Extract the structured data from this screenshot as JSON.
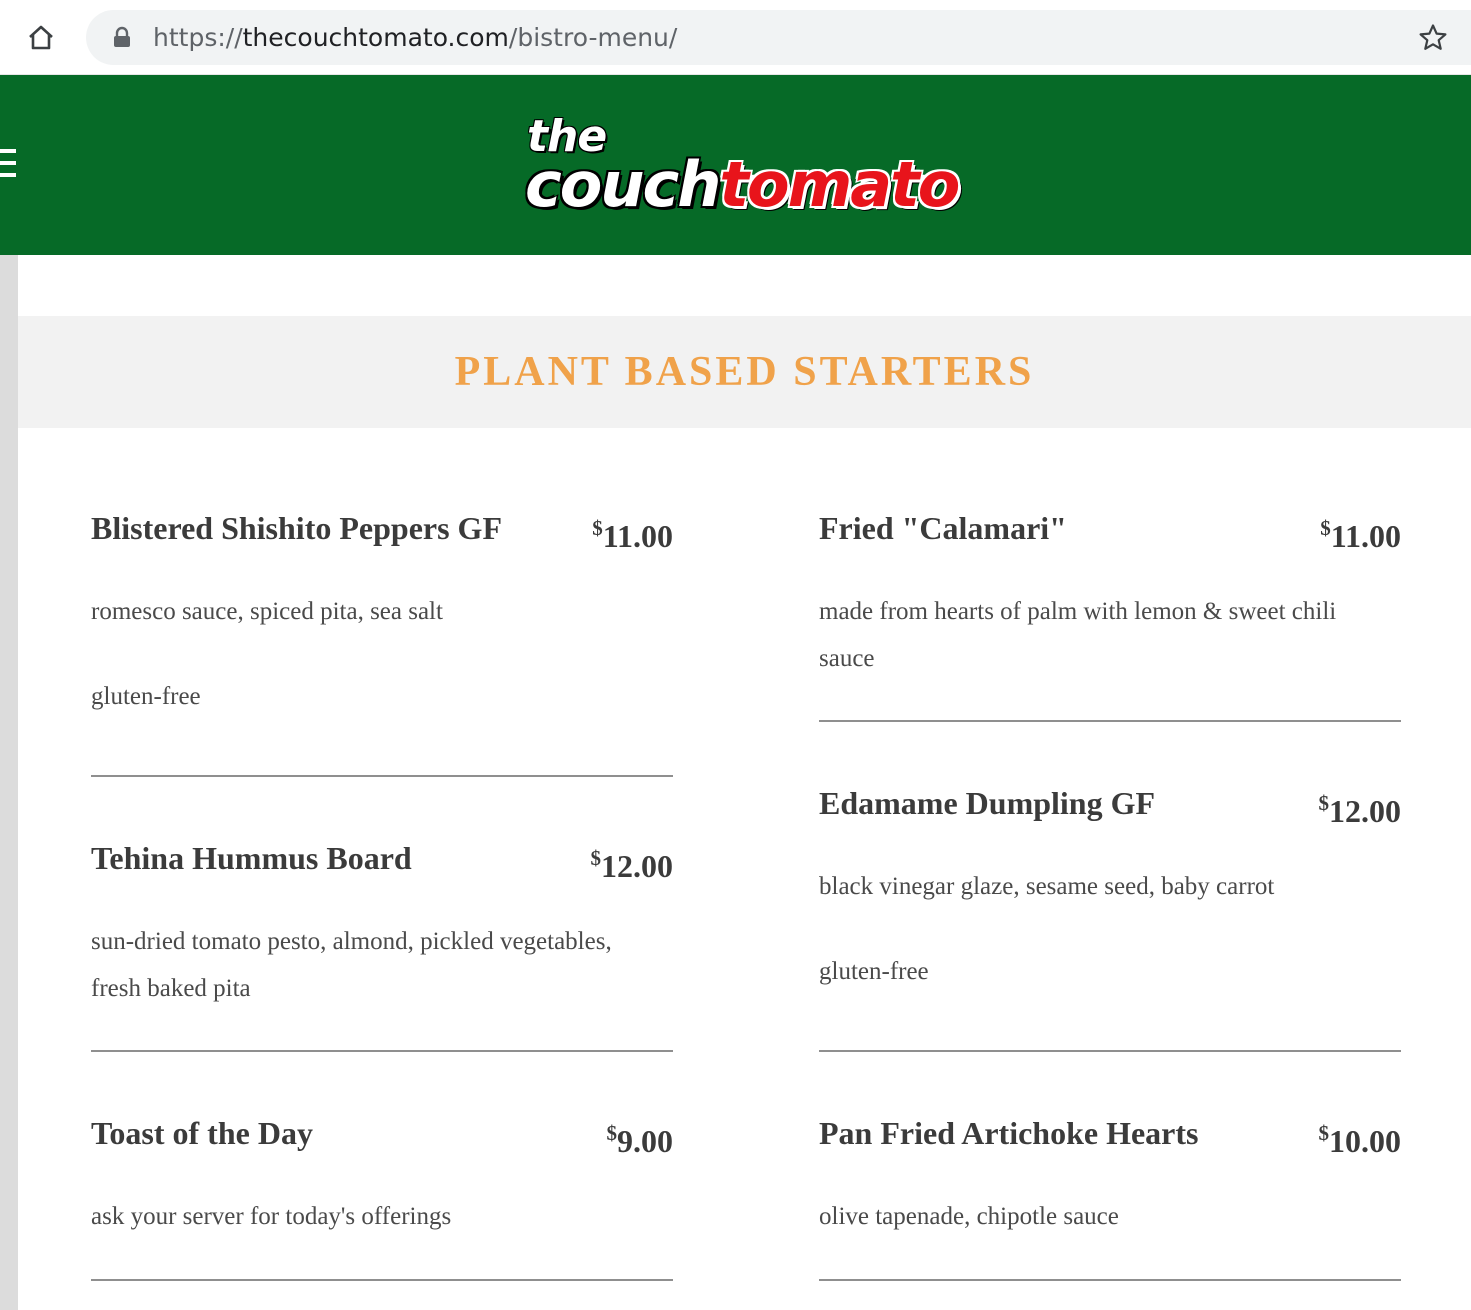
{
  "browser": {
    "url_scheme": "https://",
    "url_host": "thecouchtomato.com",
    "url_path": "/bistro-menu/"
  },
  "header": {
    "logo_the": "the",
    "logo_couch": "couch",
    "logo_tomato": "tomato",
    "background_color": "#066a27",
    "accent_color": "#e8141b"
  },
  "section": {
    "title": "PLANT BASED STARTERS",
    "title_color": "#f0a24a"
  },
  "menu": {
    "left": [
      {
        "name": "Blistered Shishito Peppers GF",
        "price_symbol": "$",
        "price": "11.00",
        "description": "romesco sauce, spiced pita, sea salt",
        "note": "gluten-free"
      },
      {
        "name": "Tehina Hummus Board",
        "price_symbol": "$",
        "price": "12.00",
        "description": "sun-dried tomato pesto, almond, pickled vegetables, fresh baked pita"
      },
      {
        "name": "Toast of the Day",
        "price_symbol": "$",
        "price": "9.00",
        "description": "ask your server for today's offerings"
      }
    ],
    "right": [
      {
        "name": "Fried \"Calamari\"",
        "price_symbol": "$",
        "price": "11.00",
        "description": "made from hearts of palm with lemon & sweet chili sauce"
      },
      {
        "name": "Edamame Dumpling GF",
        "price_symbol": "$",
        "price": "12.00",
        "description": "black vinegar glaze, sesame seed, baby carrot",
        "note": "gluten-free"
      },
      {
        "name": "Pan Fried Artichoke Hearts",
        "price_symbol": "$",
        "price": "10.00",
        "description": "olive tapenade, chipotle sauce"
      }
    ]
  }
}
